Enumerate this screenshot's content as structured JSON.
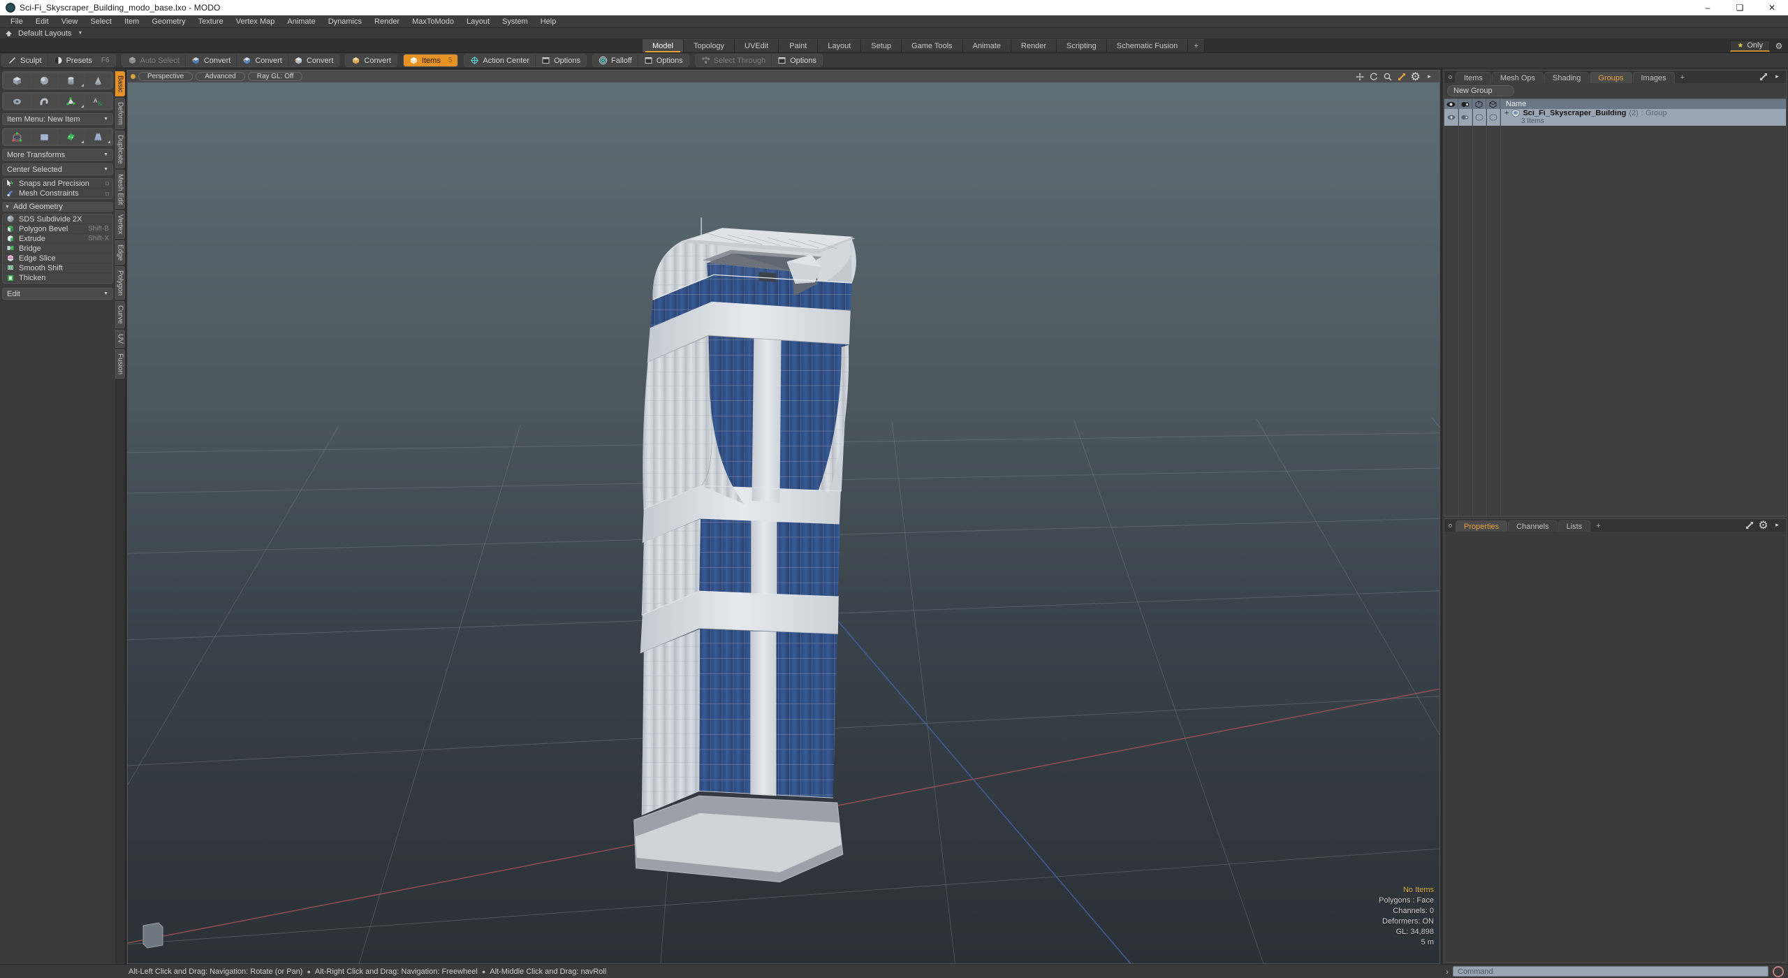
{
  "window": {
    "title": "Sci-Fi_Skyscraper_Building_modo_base.lxo - MODO",
    "app_icon": "modo-icon",
    "minimize": "–",
    "maximize": "❑",
    "close": "✕"
  },
  "menubar": {
    "items": [
      {
        "label": "File"
      },
      {
        "label": "Edit"
      },
      {
        "label": "View"
      },
      {
        "label": "Select"
      },
      {
        "label": "Item"
      },
      {
        "label": "Geometry"
      },
      {
        "label": "Texture"
      },
      {
        "label": "Vertex Map"
      },
      {
        "label": "Animate"
      },
      {
        "label": "Dynamics"
      },
      {
        "label": "Render"
      },
      {
        "label": "MaxToModo"
      },
      {
        "label": "Layout"
      },
      {
        "label": "System"
      },
      {
        "label": "Help"
      }
    ]
  },
  "layoutbar": {
    "home_icon": "home-icon",
    "label": "Default Layouts",
    "caret": "▼"
  },
  "layout_tabs": {
    "items": [
      {
        "label": "Model",
        "active": true
      },
      {
        "label": "Topology",
        "active": false
      },
      {
        "label": "UVEdit",
        "active": false
      },
      {
        "label": "Paint",
        "active": false
      },
      {
        "label": "Layout",
        "active": false
      },
      {
        "label": "Setup",
        "active": false
      },
      {
        "label": "Game Tools",
        "active": false
      },
      {
        "label": "Animate",
        "active": false
      },
      {
        "label": "Render",
        "active": false
      },
      {
        "label": "Scripting",
        "active": false
      },
      {
        "label": "Schematic Fusion",
        "active": false
      }
    ],
    "add_label": "+",
    "only_label": "Only",
    "star_icon": "star-icon",
    "gear_icon": "gear-icon"
  },
  "toolbar": {
    "groups": [
      {
        "buttons": [
          {
            "label": "Sculpt",
            "icon": "sculpt-brush-icon",
            "state": "normal",
            "shortcut": ""
          },
          {
            "label": "Presets",
            "icon": "presets-sphere-icon",
            "state": "normal",
            "shortcut": "F6"
          }
        ]
      },
      {
        "buttons": [
          {
            "label": "Auto Select",
            "icon": "cube-grey-icon",
            "state": "disabled",
            "shortcut": ""
          },
          {
            "label": "Convert",
            "icon": "cube-convert-icon",
            "state": "normal",
            "shortcut": ""
          },
          {
            "label": "Convert",
            "icon": "cube-convert-icon",
            "state": "normal",
            "shortcut": ""
          },
          {
            "label": "Convert",
            "icon": "cube-convert-icon",
            "state": "normal",
            "shortcut": ""
          }
        ]
      },
      {
        "buttons": [
          {
            "label": "Convert",
            "icon": "cube-convert-icon",
            "state": "normal",
            "shortcut": ""
          }
        ]
      },
      {
        "buttons": [
          {
            "label": "Items",
            "icon": "cube-orange-icon",
            "state": "selected",
            "shortcut": "5"
          }
        ]
      },
      {
        "buttons": [
          {
            "label": "Action Center",
            "icon": "crosshair-icon",
            "state": "normal",
            "shortcut": ""
          },
          {
            "label": "Options",
            "icon": "panel-icon",
            "state": "normal",
            "shortcut": ""
          }
        ]
      },
      {
        "buttons": [
          {
            "label": "Falloff",
            "icon": "falloff-target-icon",
            "state": "normal",
            "shortcut": ""
          },
          {
            "label": "Options",
            "icon": "panel-icon",
            "state": "normal",
            "shortcut": ""
          }
        ]
      },
      {
        "buttons": [
          {
            "label": "Select Through",
            "icon": "select-through-icon",
            "state": "disabled",
            "shortcut": ""
          },
          {
            "label": "Options",
            "icon": "panel-icon",
            "state": "normal",
            "shortcut": ""
          }
        ]
      }
    ]
  },
  "left_panel": {
    "primitives_row1": [
      {
        "name": "cube-primitive",
        "has_corner": false
      },
      {
        "name": "sphere-primitive",
        "has_corner": false
      },
      {
        "name": "cylinder-primitive",
        "has_corner": true
      },
      {
        "name": "cone-primitive",
        "has_corner": false
      }
    ],
    "primitives_row2": [
      {
        "name": "torus-primitive",
        "has_corner": false
      },
      {
        "name": "tube-primitive",
        "has_corner": false
      },
      {
        "name": "polygon-primitive",
        "has_corner": true
      },
      {
        "name": "text-primitive",
        "has_corner": false
      }
    ],
    "item_menu": {
      "label": "Item Menu: New Item",
      "caret": "▼"
    },
    "transforms_row": [
      {
        "name": "transform-gizmo-tool",
        "has_corner": false
      },
      {
        "name": "bend-tool",
        "has_corner": false
      },
      {
        "name": "twist-tool",
        "has_corner": true
      },
      {
        "name": "taper-tool",
        "has_corner": true
      }
    ],
    "more_transforms": {
      "label": "More Transforms",
      "caret": "▼"
    },
    "center_selected": {
      "label": "Center Selected",
      "caret": "▼"
    },
    "snaps": [
      {
        "label": "Snaps and Precision",
        "icon": "snap-arrow-icon"
      },
      {
        "label": "Mesh Constraints",
        "icon": "mesh-constraint-icon"
      }
    ],
    "add_geometry_header": {
      "label": "Add Geometry",
      "tri": "▼"
    },
    "geometry_tools": [
      {
        "label": "SDS Subdivide 2X",
        "icon": "sds-subdivide-icon",
        "shortcut": ""
      },
      {
        "label": "Polygon Bevel",
        "icon": "polygon-bevel-icon",
        "shortcut": "Shift-B"
      },
      {
        "label": "Extrude",
        "icon": "extrude-icon",
        "shortcut": "Shift-X"
      },
      {
        "label": "Bridge",
        "icon": "bridge-icon",
        "shortcut": ""
      },
      {
        "label": "Edge Slice",
        "icon": "edge-slice-icon",
        "shortcut": ""
      },
      {
        "label": "Smooth Shift",
        "icon": "smooth-shift-icon",
        "shortcut": ""
      },
      {
        "label": "Thicken",
        "icon": "thicken-icon",
        "shortcut": ""
      }
    ],
    "edit_dropdown": {
      "label": "Edit",
      "caret": "▼"
    },
    "vertical_tabs": [
      {
        "label": "Basic",
        "active": true
      },
      {
        "label": "Deform",
        "active": false
      },
      {
        "label": "Duplicate",
        "active": false
      },
      {
        "label": "Mesh Edit",
        "active": false
      },
      {
        "label": "Vertex",
        "active": false
      },
      {
        "label": "Edge",
        "active": false
      },
      {
        "label": "Polygon",
        "active": false
      },
      {
        "label": "Curve",
        "active": false
      },
      {
        "label": "UV",
        "active": false
      },
      {
        "label": "Fusion",
        "active": false
      }
    ]
  },
  "viewport": {
    "header": {
      "dot_icon": "viewport-dot-icon",
      "pills": [
        {
          "label": "Perspective"
        },
        {
          "label": "Advanced"
        },
        {
          "label": "Ray GL: Off"
        }
      ],
      "tools": [
        {
          "name": "move-icon",
          "glyph": "✥"
        },
        {
          "name": "rotate-icon",
          "glyph": "↻"
        },
        {
          "name": "zoom-icon",
          "glyph": "⚲"
        },
        {
          "name": "fit-icon",
          "glyph": "⤡"
        },
        {
          "name": "gear-icon",
          "glyph": "⚙"
        },
        {
          "name": "more-arrow-icon",
          "glyph": "▸"
        }
      ]
    },
    "stats": [
      {
        "label": "No Items",
        "highlight": true
      },
      {
        "label": "Polygons : Face",
        "highlight": false
      },
      {
        "label": "Channels: 0",
        "highlight": false
      },
      {
        "label": "Deformers: ON",
        "highlight": false
      },
      {
        "label": "GL: 34,898",
        "highlight": false
      },
      {
        "label": "5 m",
        "highlight": false
      }
    ],
    "colors": {
      "bg_top": "#5d6a70",
      "bg_bottom": "#2b3136",
      "grid": "#7d868c",
      "axis_x": "#b04a4a",
      "axis_z": "#4a66b0",
      "model_light": "#d6d9dd",
      "model_glass": "#2f4f86"
    }
  },
  "right_panel": {
    "top_tabs": [
      {
        "label": "Items",
        "active": false
      },
      {
        "label": "Mesh Ops",
        "active": false
      },
      {
        "label": "Shading",
        "active": false
      },
      {
        "label": "Groups",
        "active": true
      },
      {
        "label": "Images",
        "active": false
      }
    ],
    "top_add": "+",
    "top_tools": [
      {
        "name": "expand-icon",
        "glyph": "⤡"
      },
      {
        "name": "more-arrow-icon",
        "glyph": "▸"
      }
    ],
    "new_group_button": "New Group",
    "tree_columns": [
      {
        "name": "visibility-column",
        "icon": "eye-icon"
      },
      {
        "name": "shading-column",
        "icon": "shade-sphere-icon"
      },
      {
        "name": "render-column",
        "icon": "cube-outline-icon"
      },
      {
        "name": "wireframe-column",
        "icon": "cube-outline-icon"
      }
    ],
    "tree_name_header": "Name",
    "tree_rows": [
      {
        "expander": "+",
        "icon": "group-shield-icon",
        "name": "Sci_Fi_Skyscraper_Building",
        "count": "(2)",
        "type": ": Group",
        "sub": "3 Items"
      }
    ],
    "bottom_tabs": [
      {
        "label": "Properties",
        "active": true
      },
      {
        "label": "Channels",
        "active": false
      },
      {
        "label": "Lists",
        "active": false
      }
    ],
    "bottom_add": "+",
    "bottom_tools": [
      {
        "name": "expand-icon",
        "glyph": "⤡"
      },
      {
        "name": "gear-icon",
        "glyph": "⚙"
      },
      {
        "name": "more-arrow-icon",
        "glyph": "▸"
      }
    ]
  },
  "statusbar": {
    "hints": [
      "Alt-Left Click and Drag: Navigation: Rotate (or Pan)",
      "Alt-Right Click and Drag: Navigation: Freewheel",
      "Alt-Middle Click and Drag: navRoll"
    ],
    "bullet": "●",
    "command_chevron": "›",
    "command_placeholder": "Command",
    "record_icon": "record-icon"
  }
}
